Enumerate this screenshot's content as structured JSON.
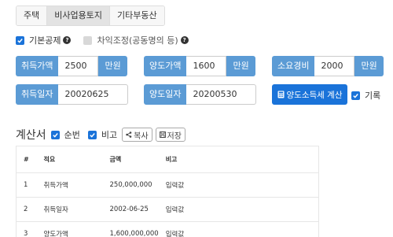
{
  "tabs": [
    "주택",
    "비사업용토지",
    "기타부동산"
  ],
  "options": {
    "basic_deduction": "기본공제",
    "gain_adjustment": "차익조정(공동명의 등)"
  },
  "fields": {
    "acq_price_label": "취득가액",
    "acq_price_value": "2500",
    "acq_price_unit": "만원",
    "transfer_price_label": "양도가액",
    "transfer_price_value": "1600",
    "transfer_price_unit": "만원",
    "expense_label": "소요경비",
    "expense_value": "2000",
    "expense_unit": "만원",
    "acq_date_label": "취득일자",
    "acq_date_value": "20020625",
    "transfer_date_label": "양도일자",
    "transfer_date_value": "20200530"
  },
  "calc_button": "양도소득세 계산",
  "record_label": "기록",
  "section": {
    "title": "계산서",
    "seq_label": "순번",
    "note_label": "비고",
    "copy_label": "복사",
    "save_label": "저장"
  },
  "table": {
    "headers": [
      "#",
      "적요",
      "금액",
      "비고"
    ],
    "rows": [
      [
        "1",
        "취득가액",
        "250,000,000",
        "입력값"
      ],
      [
        "2",
        "취득일자",
        "2002-06-25",
        "입력값"
      ],
      [
        "3",
        "양도가액",
        "1,600,000,000",
        "입력값"
      ]
    ]
  }
}
